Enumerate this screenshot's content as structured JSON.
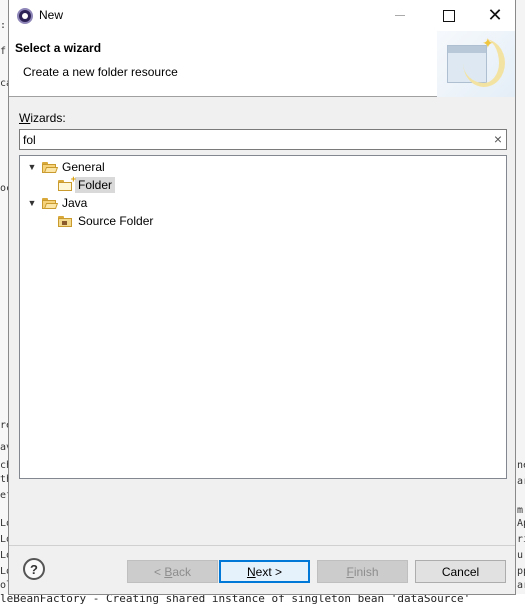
{
  "window": {
    "title": "New"
  },
  "banner": {
    "title": "Select a wizard",
    "description": "Create a new folder resource"
  },
  "wizards_label": {
    "mnemonic": "W",
    "rest": "izards:"
  },
  "filter": {
    "value": "fol",
    "clear_glyph": "×"
  },
  "tree": {
    "general": {
      "label": "General",
      "expanded": true
    },
    "folder": {
      "label": "Folder",
      "selected": true
    },
    "java": {
      "label": "Java",
      "expanded": true
    },
    "source_folder": {
      "label": "Source Folder"
    }
  },
  "buttons": {
    "help": "?",
    "back": {
      "prefix": "< ",
      "mnemonic": "B",
      "rest": "ack",
      "enabled": false
    },
    "next": {
      "mnemonic": "N",
      "rest": "ext >",
      "enabled": true,
      "default": true
    },
    "finish": {
      "mnemonic": "F",
      "rest": "inish",
      "enabled": false
    },
    "cancel": {
      "label": "Cancel",
      "enabled": true
    }
  },
  "background": {
    "left_fragments": [
      ":",
      "f",
      "ca",
      "oc",
      "re",
      "av",
      "ch",
      "th",
      "ef",
      "Lo",
      "Lo",
      "Lo",
      "Lo",
      "ol"
    ],
    "right_fragments": [
      "ne",
      "ar",
      "m",
      "Ap",
      "ri",
      "u",
      "pp",
      "ar"
    ],
    "console_line": "leBeanFactory - Creating shared instance of singleton bean 'dataSource'"
  },
  "colors": {
    "default_button_border": "#0078d7",
    "selection": "#d9d9d9",
    "folder": "#f6d27a"
  }
}
